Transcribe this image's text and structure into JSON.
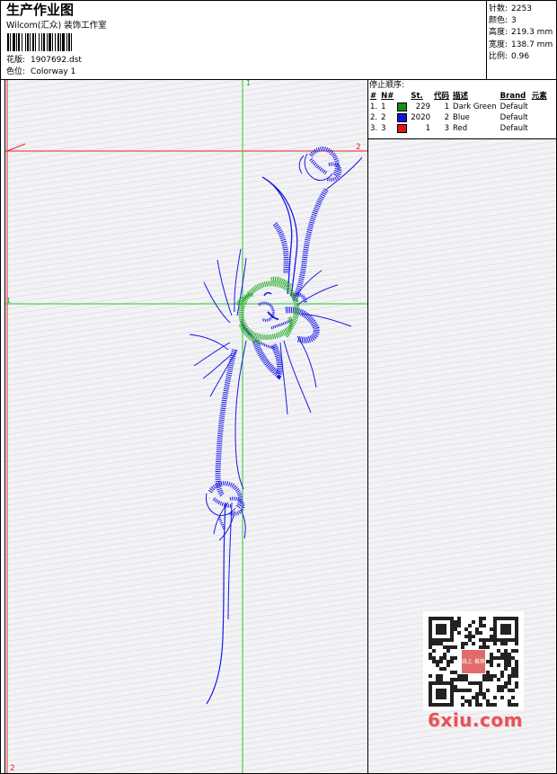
{
  "header": {
    "title": "生产作业图",
    "company": "Wilcom(汇众) 装饰工作室",
    "design_label": "花版:",
    "design_file": "1907692.dst",
    "colorway_label": "色位:",
    "colorway": "Colorway 1"
  },
  "stats": [
    {
      "label": "针数:",
      "value": "2253"
    },
    {
      "label": "颜色:",
      "value": "3"
    },
    {
      "label": "高度:",
      "value": "219.3 mm"
    },
    {
      "label": "宽度:",
      "value": "138.7 mm"
    },
    {
      "label": "比例:",
      "value": "0.96"
    }
  ],
  "sequence": {
    "title": "停止顺序:",
    "headers": [
      "#",
      "N#",
      "St.",
      "代码",
      "描述",
      "Brand",
      "元素"
    ],
    "rows": [
      {
        "idx": "1.",
        "n": "1",
        "color": "#1a8a1a",
        "st": "229",
        "code": "1",
        "desc": "Dark Green",
        "brand": "Default"
      },
      {
        "idx": "2.",
        "n": "2",
        "color": "#1414e0",
        "st": "2020",
        "code": "2",
        "desc": "Blue",
        "brand": "Default"
      },
      {
        "idx": "3.",
        "n": "3",
        "color": "#e01414",
        "st": "1",
        "code": "3",
        "desc": "Red",
        "brand": "Default"
      }
    ]
  },
  "canvas": {
    "marker_top_1": "1",
    "marker_left_1": "1",
    "marker_right_2": "2",
    "marker_bottom_2": "2",
    "colors": {
      "green": "#22aa22",
      "blue": "#1a1ae6",
      "red": "#ee2222",
      "dark_green": "#1a8a1a"
    }
  },
  "watermark": "6xiu.com",
  "qr_badge": "线上 推荐"
}
